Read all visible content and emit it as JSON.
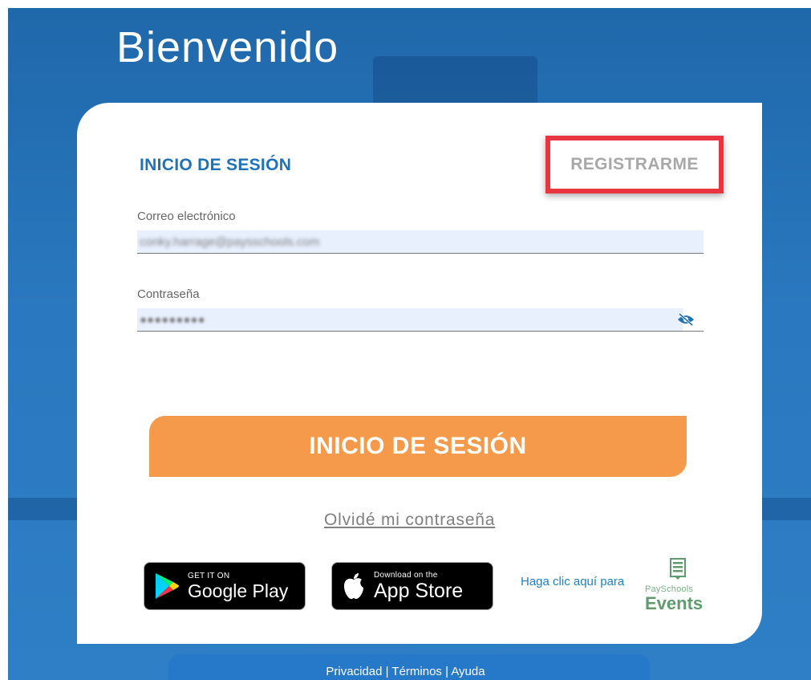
{
  "page": {
    "welcome": "Bienvenido"
  },
  "login": {
    "title": "INICIO DE SESIÓN",
    "register_label": "REGISTRARME",
    "email_label": "Correo electrónico",
    "email_value": "conky.harrage@paysschools.com",
    "password_label": "Contraseña",
    "password_value": "●●●●●●●●●",
    "password_toggle_icon": "eye-slash-icon",
    "submit_label": "INICIO DE SESIÓN",
    "forgot_label": "Olvidé mi contraseña"
  },
  "apps": {
    "google_small": "GET IT ON",
    "google_big": "Google Play",
    "apple_small": "Download on the",
    "apple_big": "App Store",
    "events_link": "Haga clic aquí para",
    "events_logo_line1": "PaySchools",
    "events_logo_line2": "Events"
  },
  "footer": {
    "privacy": "Privacidad",
    "terms": "Términos",
    "help": "Ayuda",
    "separator": " | "
  },
  "colors": {
    "accent_blue": "#1e72b8",
    "signin_orange": "#f59a4a",
    "highlight_red": "#e8353f",
    "events_green": "#5f9b6c"
  }
}
